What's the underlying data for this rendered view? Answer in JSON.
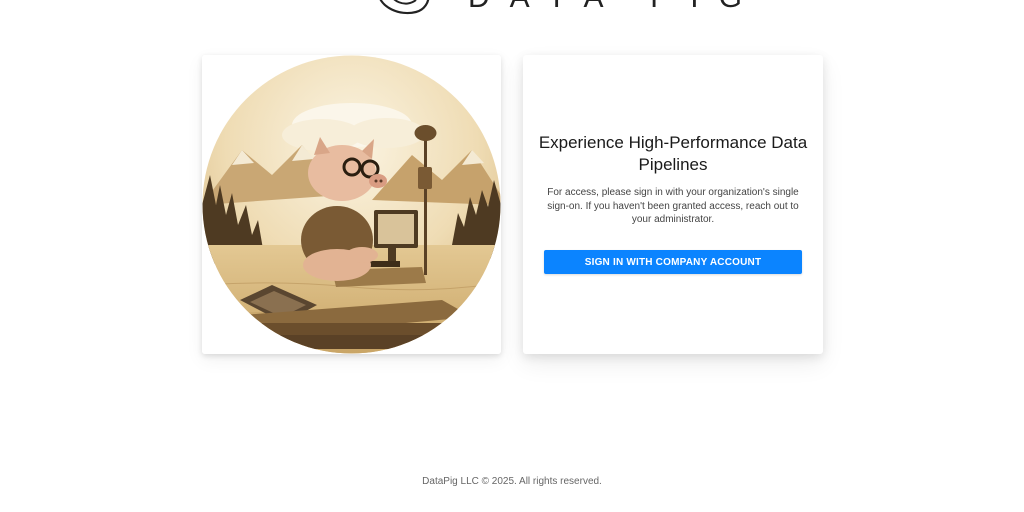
{
  "brand": {
    "logo_text": "DATA PIG"
  },
  "login": {
    "title": "Experience High-Performance Data Pipelines",
    "description": "For access, please sign in with your organization's single sign-on. If you haven't been granted access, reach out to your administrator.",
    "sso_button_label": "SIGN IN WITH COMPANY ACCOUNT"
  },
  "hero_image": {
    "icon": "pig-on-raft-illustration"
  },
  "footer": {
    "copyright": "DataPig LLC © 2025. All rights reserved."
  },
  "colors": {
    "accent": "#0b84ff",
    "sepia_light": "#f3e6c8",
    "sepia_dark": "#5a4126"
  }
}
